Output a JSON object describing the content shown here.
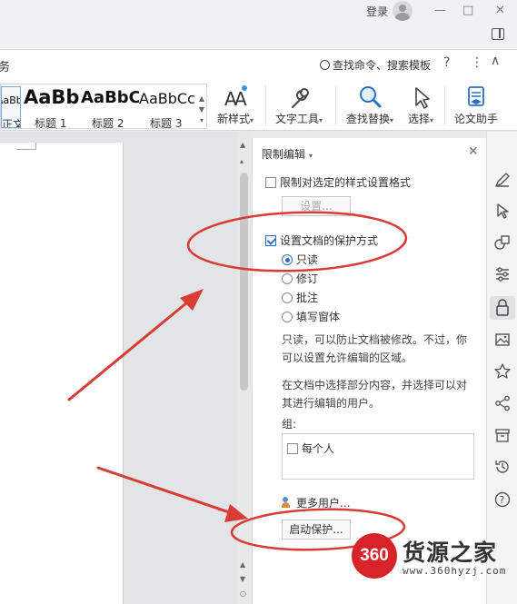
{
  "titlebar": {
    "login_label": "登录",
    "min_icon": "minimize-icon",
    "max_icon": "maximize-icon",
    "close_icon": "close-icon"
  },
  "commandbar": {
    "tab_tail": "务",
    "search_label": "查找命令、搜索模板",
    "help": "?",
    "more": "⋮",
    "collapse": "∧"
  },
  "styles": [
    {
      "sample": "AaBbCcDd",
      "name": "正文"
    },
    {
      "sample": "AaBb",
      "name": "标题 1"
    },
    {
      "sample": "AaBbC",
      "name": "标题 2"
    },
    {
      "sample": "AaBbCc",
      "name": "标题 3"
    }
  ],
  "ribbon": {
    "new_style": "新样式",
    "text_tools": "文字工具",
    "find_replace": "查找替换",
    "select": "选择",
    "doc_assistant": "论文助手"
  },
  "panel": {
    "title": "限制编辑",
    "limit_format_label": "限制对选定的样式设置格式",
    "limit_format_checked": false,
    "settings_button": "设置...",
    "set_protection_label": "设置文档的保护方式",
    "set_protection_checked": true,
    "options": [
      {
        "label": "只读",
        "selected": true
      },
      {
        "label": "修订",
        "selected": false
      },
      {
        "label": "批注",
        "selected": false
      },
      {
        "label": "填写窗体",
        "selected": false
      }
    ],
    "desc1": "只读，可以防止文档被修改。不过，你可以设置允许编辑的区域。",
    "desc2": "在文档中选择部分内容，并选择可以对其进行编辑的用户。",
    "group_label": "组:",
    "everyone_label": "每个人",
    "everyone_checked": false,
    "more_users": "更多用户...",
    "start_protection": "启动保护..."
  },
  "tools": [
    "pen-icon",
    "cursor-icon",
    "shapes-icon",
    "sliders-icon",
    "lock-icon",
    "image-icon",
    "star-icon",
    "share-icon",
    "archive-icon",
    "history-icon",
    "help-icon"
  ],
  "watermark": {
    "badge": "360",
    "brand": "货源之家",
    "site": "www.360hyzj.com"
  },
  "colors": {
    "annotation": "#d93b35",
    "accent": "#2a6fc7",
    "watermark_red": "#d9232a"
  }
}
